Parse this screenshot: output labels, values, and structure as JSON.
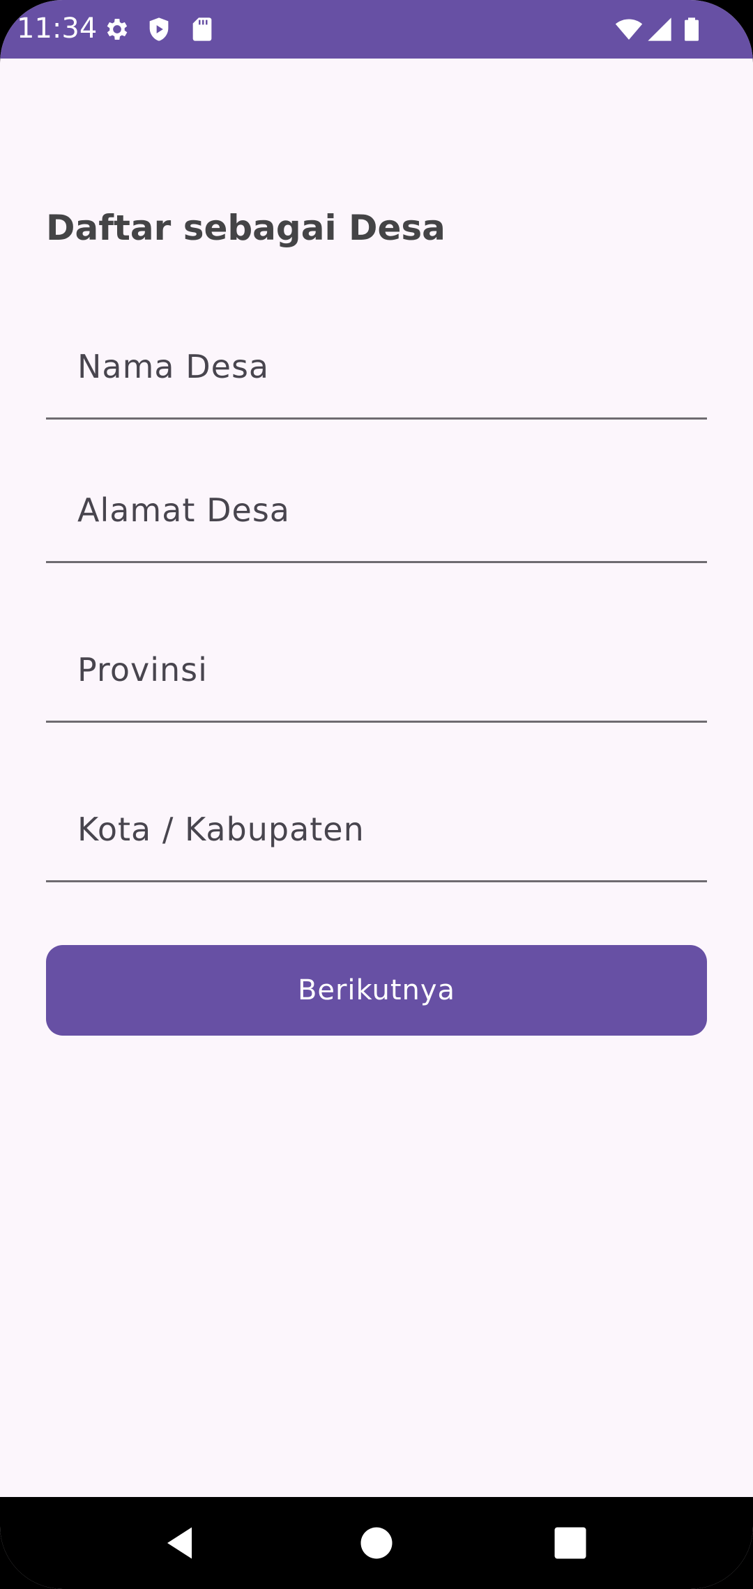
{
  "status_bar": {
    "time": "11:34",
    "left_icons": [
      "gear-icon",
      "shield-play-icon",
      "sd-card-icon"
    ],
    "right_icons": [
      "wifi-icon",
      "cell-signal-icon",
      "battery-icon"
    ],
    "background": "#6750a4"
  },
  "form": {
    "title": "Daftar sebagai Desa",
    "fields": [
      {
        "placeholder": "Nama Desa",
        "value": ""
      },
      {
        "placeholder": "Alamat Desa",
        "value": ""
      },
      {
        "placeholder": "Provinsi",
        "value": ""
      },
      {
        "placeholder": "Kota / Kabupaten",
        "value": ""
      }
    ],
    "submit_label": "Berikutnya",
    "accent": "#6750a4"
  },
  "nav_bar": {
    "buttons": [
      "back-icon",
      "home-icon",
      "recents-icon"
    ]
  }
}
